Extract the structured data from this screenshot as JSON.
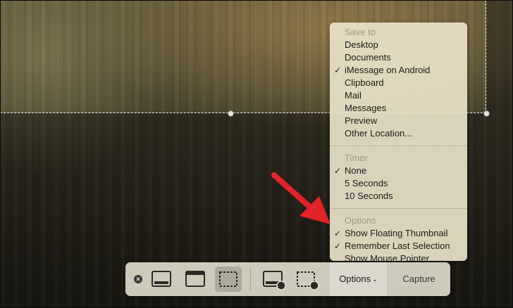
{
  "menu": {
    "sections": [
      {
        "header": "Save to",
        "items": [
          {
            "label": "Desktop",
            "checked": false
          },
          {
            "label": "Documents",
            "checked": false
          },
          {
            "label": "iMessage on Android",
            "checked": true
          },
          {
            "label": "Clipboard",
            "checked": false
          },
          {
            "label": "Mail",
            "checked": false
          },
          {
            "label": "Messages",
            "checked": false
          },
          {
            "label": "Preview",
            "checked": false
          },
          {
            "label": "Other Location...",
            "checked": false
          }
        ]
      },
      {
        "header": "Timer",
        "items": [
          {
            "label": "None",
            "checked": true
          },
          {
            "label": "5 Seconds",
            "checked": false
          },
          {
            "label": "10 Seconds",
            "checked": false
          }
        ]
      },
      {
        "header": "Options",
        "items": [
          {
            "label": "Show Floating Thumbnail",
            "checked": true
          },
          {
            "label": "Remember Last Selection",
            "checked": true
          },
          {
            "label": "Show Mouse Pointer",
            "checked": false
          }
        ]
      }
    ],
    "check_glyph": "✓"
  },
  "toolbar": {
    "close_glyph": "✕",
    "options_label": "Options",
    "options_chevron": "⌄",
    "capture_label": "Capture",
    "tools": [
      {
        "name": "capture-entire-screen-icon"
      },
      {
        "name": "capture-selected-window-icon"
      },
      {
        "name": "capture-selected-portion-icon",
        "selected": true
      },
      {
        "name": "record-entire-screen-icon"
      },
      {
        "name": "record-selected-portion-icon"
      }
    ]
  },
  "colors": {
    "arrow": "#e4222a",
    "menu_bg": "#e8e1c8",
    "toolbar_bg": "#e2decd"
  }
}
